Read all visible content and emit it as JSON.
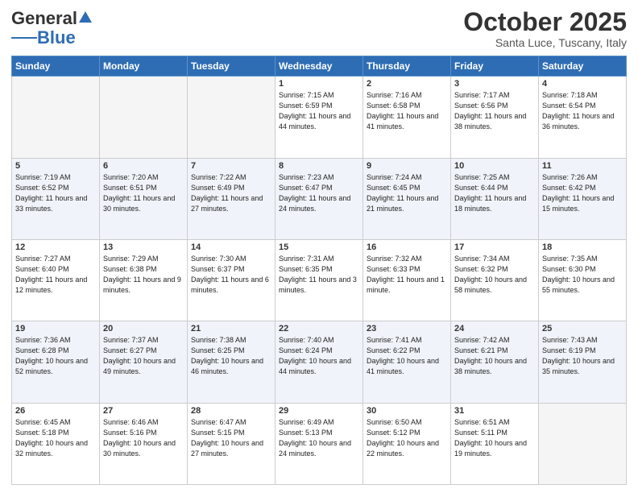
{
  "header": {
    "logo_general": "General",
    "logo_blue": "Blue",
    "title": "October 2025",
    "location": "Santa Luce, Tuscany, Italy"
  },
  "weekdays": [
    "Sunday",
    "Monday",
    "Tuesday",
    "Wednesday",
    "Thursday",
    "Friday",
    "Saturday"
  ],
  "weeks": [
    [
      {
        "day": "",
        "sunrise": "",
        "sunset": "",
        "daylight": "",
        "empty": true
      },
      {
        "day": "",
        "sunrise": "",
        "sunset": "",
        "daylight": "",
        "empty": true
      },
      {
        "day": "",
        "sunrise": "",
        "sunset": "",
        "daylight": "",
        "empty": true
      },
      {
        "day": "1",
        "sunrise": "Sunrise: 7:15 AM",
        "sunset": "Sunset: 6:59 PM",
        "daylight": "Daylight: 11 hours and 44 minutes.",
        "empty": false
      },
      {
        "day": "2",
        "sunrise": "Sunrise: 7:16 AM",
        "sunset": "Sunset: 6:58 PM",
        "daylight": "Daylight: 11 hours and 41 minutes.",
        "empty": false
      },
      {
        "day": "3",
        "sunrise": "Sunrise: 7:17 AM",
        "sunset": "Sunset: 6:56 PM",
        "daylight": "Daylight: 11 hours and 38 minutes.",
        "empty": false
      },
      {
        "day": "4",
        "sunrise": "Sunrise: 7:18 AM",
        "sunset": "Sunset: 6:54 PM",
        "daylight": "Daylight: 11 hours and 36 minutes.",
        "empty": false
      }
    ],
    [
      {
        "day": "5",
        "sunrise": "Sunrise: 7:19 AM",
        "sunset": "Sunset: 6:52 PM",
        "daylight": "Daylight: 11 hours and 33 minutes.",
        "empty": false
      },
      {
        "day": "6",
        "sunrise": "Sunrise: 7:20 AM",
        "sunset": "Sunset: 6:51 PM",
        "daylight": "Daylight: 11 hours and 30 minutes.",
        "empty": false
      },
      {
        "day": "7",
        "sunrise": "Sunrise: 7:22 AM",
        "sunset": "Sunset: 6:49 PM",
        "daylight": "Daylight: 11 hours and 27 minutes.",
        "empty": false
      },
      {
        "day": "8",
        "sunrise": "Sunrise: 7:23 AM",
        "sunset": "Sunset: 6:47 PM",
        "daylight": "Daylight: 11 hours and 24 minutes.",
        "empty": false
      },
      {
        "day": "9",
        "sunrise": "Sunrise: 7:24 AM",
        "sunset": "Sunset: 6:45 PM",
        "daylight": "Daylight: 11 hours and 21 minutes.",
        "empty": false
      },
      {
        "day": "10",
        "sunrise": "Sunrise: 7:25 AM",
        "sunset": "Sunset: 6:44 PM",
        "daylight": "Daylight: 11 hours and 18 minutes.",
        "empty": false
      },
      {
        "day": "11",
        "sunrise": "Sunrise: 7:26 AM",
        "sunset": "Sunset: 6:42 PM",
        "daylight": "Daylight: 11 hours and 15 minutes.",
        "empty": false
      }
    ],
    [
      {
        "day": "12",
        "sunrise": "Sunrise: 7:27 AM",
        "sunset": "Sunset: 6:40 PM",
        "daylight": "Daylight: 11 hours and 12 minutes.",
        "empty": false
      },
      {
        "day": "13",
        "sunrise": "Sunrise: 7:29 AM",
        "sunset": "Sunset: 6:38 PM",
        "daylight": "Daylight: 11 hours and 9 minutes.",
        "empty": false
      },
      {
        "day": "14",
        "sunrise": "Sunrise: 7:30 AM",
        "sunset": "Sunset: 6:37 PM",
        "daylight": "Daylight: 11 hours and 6 minutes.",
        "empty": false
      },
      {
        "day": "15",
        "sunrise": "Sunrise: 7:31 AM",
        "sunset": "Sunset: 6:35 PM",
        "daylight": "Daylight: 11 hours and 3 minutes.",
        "empty": false
      },
      {
        "day": "16",
        "sunrise": "Sunrise: 7:32 AM",
        "sunset": "Sunset: 6:33 PM",
        "daylight": "Daylight: 11 hours and 1 minute.",
        "empty": false
      },
      {
        "day": "17",
        "sunrise": "Sunrise: 7:34 AM",
        "sunset": "Sunset: 6:32 PM",
        "daylight": "Daylight: 10 hours and 58 minutes.",
        "empty": false
      },
      {
        "day": "18",
        "sunrise": "Sunrise: 7:35 AM",
        "sunset": "Sunset: 6:30 PM",
        "daylight": "Daylight: 10 hours and 55 minutes.",
        "empty": false
      }
    ],
    [
      {
        "day": "19",
        "sunrise": "Sunrise: 7:36 AM",
        "sunset": "Sunset: 6:28 PM",
        "daylight": "Daylight: 10 hours and 52 minutes.",
        "empty": false
      },
      {
        "day": "20",
        "sunrise": "Sunrise: 7:37 AM",
        "sunset": "Sunset: 6:27 PM",
        "daylight": "Daylight: 10 hours and 49 minutes.",
        "empty": false
      },
      {
        "day": "21",
        "sunrise": "Sunrise: 7:38 AM",
        "sunset": "Sunset: 6:25 PM",
        "daylight": "Daylight: 10 hours and 46 minutes.",
        "empty": false
      },
      {
        "day": "22",
        "sunrise": "Sunrise: 7:40 AM",
        "sunset": "Sunset: 6:24 PM",
        "daylight": "Daylight: 10 hours and 44 minutes.",
        "empty": false
      },
      {
        "day": "23",
        "sunrise": "Sunrise: 7:41 AM",
        "sunset": "Sunset: 6:22 PM",
        "daylight": "Daylight: 10 hours and 41 minutes.",
        "empty": false
      },
      {
        "day": "24",
        "sunrise": "Sunrise: 7:42 AM",
        "sunset": "Sunset: 6:21 PM",
        "daylight": "Daylight: 10 hours and 38 minutes.",
        "empty": false
      },
      {
        "day": "25",
        "sunrise": "Sunrise: 7:43 AM",
        "sunset": "Sunset: 6:19 PM",
        "daylight": "Daylight: 10 hours and 35 minutes.",
        "empty": false
      }
    ],
    [
      {
        "day": "26",
        "sunrise": "Sunrise: 6:45 AM",
        "sunset": "Sunset: 5:18 PM",
        "daylight": "Daylight: 10 hours and 32 minutes.",
        "empty": false
      },
      {
        "day": "27",
        "sunrise": "Sunrise: 6:46 AM",
        "sunset": "Sunset: 5:16 PM",
        "daylight": "Daylight: 10 hours and 30 minutes.",
        "empty": false
      },
      {
        "day": "28",
        "sunrise": "Sunrise: 6:47 AM",
        "sunset": "Sunset: 5:15 PM",
        "daylight": "Daylight: 10 hours and 27 minutes.",
        "empty": false
      },
      {
        "day": "29",
        "sunrise": "Sunrise: 6:49 AM",
        "sunset": "Sunset: 5:13 PM",
        "daylight": "Daylight: 10 hours and 24 minutes.",
        "empty": false
      },
      {
        "day": "30",
        "sunrise": "Sunrise: 6:50 AM",
        "sunset": "Sunset: 5:12 PM",
        "daylight": "Daylight: 10 hours and 22 minutes.",
        "empty": false
      },
      {
        "day": "31",
        "sunrise": "Sunrise: 6:51 AM",
        "sunset": "Sunset: 5:11 PM",
        "daylight": "Daylight: 10 hours and 19 minutes.",
        "empty": false
      },
      {
        "day": "",
        "sunrise": "",
        "sunset": "",
        "daylight": "",
        "empty": true
      }
    ]
  ]
}
